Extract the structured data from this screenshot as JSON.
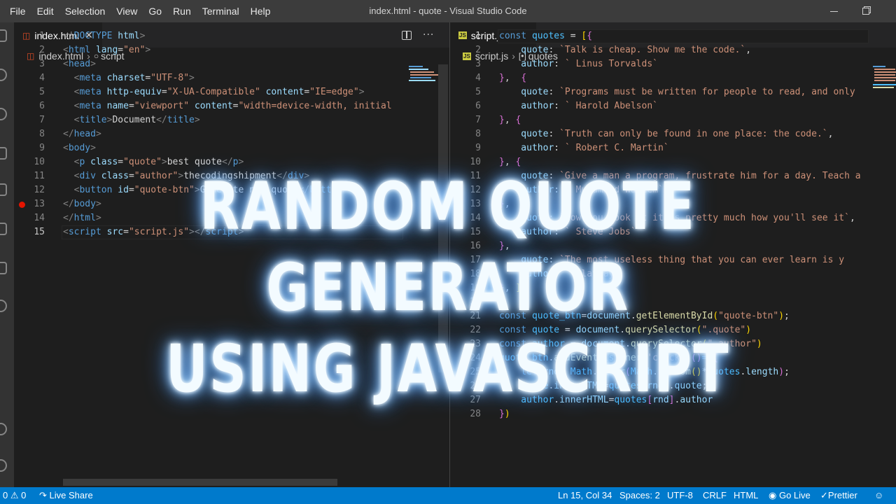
{
  "menu": [
    "File",
    "Edit",
    "Selection",
    "View",
    "Go",
    "Run",
    "Terminal",
    "Help"
  ],
  "window_title": "index.html - quote - Visual Studio Code",
  "left_editor": {
    "tab": "index.html",
    "breadcrumb": [
      "index.html",
      "script"
    ],
    "lines": [
      {
        "n": "1",
        "t": [
          [
            "<!",
            "punc"
          ],
          [
            "DOCTYPE",
            "tag"
          ],
          [
            " html",
            "attr"
          ],
          [
            ">",
            "punc"
          ]
        ]
      },
      {
        "n": "2",
        "t": [
          [
            "<",
            "punc"
          ],
          [
            "html",
            "tag"
          ],
          [
            " lang",
            "attr"
          ],
          [
            "=",
            "op"
          ],
          [
            "\"en\"",
            "str"
          ],
          [
            ">",
            "punc"
          ]
        ]
      },
      {
        "n": "3",
        "t": [
          [
            "<",
            "punc"
          ],
          [
            "head",
            "tag"
          ],
          [
            ">",
            "punc"
          ]
        ]
      },
      {
        "n": "4",
        "t": [
          [
            "  <",
            "punc"
          ],
          [
            "meta",
            "tag"
          ],
          [
            " charset",
            "attr"
          ],
          [
            "=",
            "op"
          ],
          [
            "\"UTF-8\"",
            "str"
          ],
          [
            ">",
            "punc"
          ]
        ]
      },
      {
        "n": "5",
        "t": [
          [
            "  <",
            "punc"
          ],
          [
            "meta",
            "tag"
          ],
          [
            " http-equiv",
            "attr"
          ],
          [
            "=",
            "op"
          ],
          [
            "\"X-UA-Compatible\"",
            "str"
          ],
          [
            " content",
            "attr"
          ],
          [
            "=",
            "op"
          ],
          [
            "\"IE=edge\"",
            "str"
          ],
          [
            ">",
            "punc"
          ]
        ]
      },
      {
        "n": "6",
        "t": [
          [
            "  <",
            "punc"
          ],
          [
            "meta",
            "tag"
          ],
          [
            " name",
            "attr"
          ],
          [
            "=",
            "op"
          ],
          [
            "\"viewport\"",
            "str"
          ],
          [
            " content",
            "attr"
          ],
          [
            "=",
            "op"
          ],
          [
            "\"width=device-width, initial",
            "str"
          ]
        ]
      },
      {
        "n": "7",
        "t": [
          [
            "  <",
            "punc"
          ],
          [
            "title",
            "tag"
          ],
          [
            ">",
            "punc"
          ],
          [
            "Document",
            "op"
          ],
          [
            "</",
            "punc"
          ],
          [
            "title",
            "tag"
          ],
          [
            ">",
            "punc"
          ]
        ]
      },
      {
        "n": "8",
        "t": [
          [
            "</",
            "punc"
          ],
          [
            "head",
            "tag"
          ],
          [
            ">",
            "punc"
          ]
        ]
      },
      {
        "n": "9",
        "t": [
          [
            "<",
            "punc"
          ],
          [
            "body",
            "tag"
          ],
          [
            ">",
            "punc"
          ]
        ]
      },
      {
        "n": "10",
        "t": [
          [
            "  <",
            "punc"
          ],
          [
            "p",
            "tag"
          ],
          [
            " class",
            "attr"
          ],
          [
            "=",
            "op"
          ],
          [
            "\"quote\"",
            "str"
          ],
          [
            ">",
            "punc"
          ],
          [
            "best quote",
            "op"
          ],
          [
            "</",
            "punc"
          ],
          [
            "p",
            "tag"
          ],
          [
            ">",
            "punc"
          ]
        ]
      },
      {
        "n": "11",
        "t": [
          [
            "  <",
            "punc"
          ],
          [
            "div",
            "tag"
          ],
          [
            " class",
            "attr"
          ],
          [
            "=",
            "op"
          ],
          [
            "\"author\"",
            "str"
          ],
          [
            ">",
            "punc"
          ],
          [
            "thecodingshipment",
            "op"
          ],
          [
            "</",
            "punc"
          ],
          [
            "div",
            "tag"
          ],
          [
            ">",
            "punc"
          ]
        ]
      },
      {
        "n": "12",
        "t": [
          [
            "  <",
            "punc"
          ],
          [
            "button",
            "tag"
          ],
          [
            " id",
            "attr"
          ],
          [
            "=",
            "op"
          ],
          [
            "\"quote-btn\"",
            "str"
          ],
          [
            ">",
            "punc"
          ],
          [
            "Generate new quote",
            "op"
          ],
          [
            "</",
            "punc"
          ],
          [
            "button",
            "tag"
          ],
          [
            ">",
            "punc"
          ]
        ]
      },
      {
        "n": "13",
        "t": [
          [
            "</",
            "punc"
          ],
          [
            "body",
            "tag"
          ],
          [
            ">",
            "punc"
          ]
        ],
        "breakpoint": true
      },
      {
        "n": "14",
        "t": [
          [
            "</",
            "punc"
          ],
          [
            "html",
            "tag"
          ],
          [
            ">",
            "punc"
          ]
        ]
      },
      {
        "n": "15",
        "t": [
          [
            "<",
            "punc"
          ],
          [
            "script",
            "tag"
          ],
          [
            " src",
            "attr"
          ],
          [
            "=",
            "op"
          ],
          [
            "\"script.js\"",
            "str"
          ],
          [
            ">",
            "punc"
          ],
          [
            "</",
            "punc"
          ],
          [
            "script",
            "tag"
          ],
          [
            ">",
            "punc"
          ]
        ],
        "active": true
      }
    ]
  },
  "right_editor": {
    "tab": "script.js",
    "breadcrumb": [
      "script.js",
      "quotes"
    ],
    "lines": [
      {
        "n": "1",
        "t": [
          [
            "const",
            "kw"
          ],
          [
            " quotes",
            "var"
          ],
          [
            " = ",
            "op"
          ],
          [
            "[",
            "br1"
          ],
          [
            "{",
            "br2"
          ]
        ],
        "active": true
      },
      {
        "n": "2",
        "t": [
          [
            "    quote",
            "prop"
          ],
          [
            ": ",
            "op"
          ],
          [
            "`Talk is cheap. Show me the code.`",
            "str"
          ],
          [
            ",",
            "op"
          ]
        ]
      },
      {
        "n": "3",
        "t": [
          [
            "    author",
            "prop"
          ],
          [
            ": ",
            "op"
          ],
          [
            "` Linus Torvalds`",
            "str"
          ]
        ]
      },
      {
        "n": "4",
        "t": [
          [
            "}",
            "br2"
          ],
          [
            ",  ",
            "op"
          ],
          [
            "{",
            "br2"
          ]
        ]
      },
      {
        "n": "5",
        "t": [
          [
            "    quote",
            "prop"
          ],
          [
            ": ",
            "op"
          ],
          [
            "`Programs must be written for people to read, and only",
            "str"
          ]
        ]
      },
      {
        "n": "6",
        "t": [
          [
            "    author",
            "prop"
          ],
          [
            ": ",
            "op"
          ],
          [
            "` Harold Abelson`",
            "str"
          ]
        ]
      },
      {
        "n": "7",
        "t": [
          [
            "}",
            "br2"
          ],
          [
            ", ",
            "op"
          ],
          [
            "{",
            "br2"
          ]
        ]
      },
      {
        "n": "8",
        "t": [
          [
            "    quote",
            "prop"
          ],
          [
            ": ",
            "op"
          ],
          [
            "`Truth can only be found in one place: the code.`",
            "str"
          ],
          [
            ",",
            "op"
          ]
        ]
      },
      {
        "n": "9",
        "t": [
          [
            "    author",
            "prop"
          ],
          [
            ": ",
            "op"
          ],
          [
            "` Robert C. Martin`",
            "str"
          ]
        ]
      },
      {
        "n": "10",
        "t": [
          [
            "}",
            "br2"
          ],
          [
            ", ",
            "op"
          ],
          [
            "{",
            "br2"
          ]
        ]
      },
      {
        "n": "11",
        "t": [
          [
            "    quote",
            "prop"
          ],
          [
            ": ",
            "op"
          ],
          [
            "`Give a man a program, frustrate him for a day. Teach a",
            "str"
          ]
        ]
      },
      {
        "n": "12",
        "t": [
          [
            "    author",
            "prop"
          ],
          [
            ": ",
            "op"
          ],
          [
            "` Muhammad Waseem`",
            "str"
          ]
        ]
      },
      {
        "n": "13",
        "t": [
          [
            "}",
            "br2"
          ],
          [
            ",",
            "op"
          ]
        ]
      },
      {
        "n": "14",
        "t": [
          [
            "    quote",
            "prop"
          ],
          [
            ": ",
            "op"
          ],
          [
            "`How you look at it is pretty much how you'll see it`",
            "str"
          ],
          [
            ",",
            "op"
          ]
        ]
      },
      {
        "n": "15",
        "t": [
          [
            "    author",
            "prop"
          ],
          [
            ": ",
            "op"
          ],
          [
            "` Steve Jobs`",
            "str"
          ]
        ]
      },
      {
        "n": "16",
        "t": [
          [
            "}",
            "br2"
          ],
          [
            ",",
            "op"
          ]
        ]
      },
      {
        "n": "17",
        "t": [
          [
            "    quote",
            "prop"
          ],
          [
            ": ",
            "op"
          ],
          [
            "`The most useless thing that you can ever learn is y",
            "str"
          ]
        ]
      },
      {
        "n": "18",
        "t": [
          [
            "    author",
            "prop"
          ],
          [
            ": ",
            "op"
          ],
          [
            "` Playday`",
            "str"
          ]
        ]
      },
      {
        "n": "19",
        "t": [
          [
            "}",
            "br2"
          ],
          [
            ", ",
            "op"
          ],
          [
            "]",
            "br1"
          ]
        ]
      },
      {
        "n": "20",
        "t": []
      },
      {
        "n": "21",
        "t": [
          [
            "const",
            "kw"
          ],
          [
            " quote_btn",
            "var"
          ],
          [
            "=",
            "op"
          ],
          [
            "document",
            "prop"
          ],
          [
            ".",
            "op"
          ],
          [
            "getElementById",
            "fn"
          ],
          [
            "(",
            "br1"
          ],
          [
            "\"quote-btn\"",
            "str"
          ],
          [
            ")",
            "br1"
          ],
          [
            ";",
            "op"
          ]
        ]
      },
      {
        "n": "22",
        "t": [
          [
            "const",
            "kw"
          ],
          [
            " quote",
            "var"
          ],
          [
            " = ",
            "op"
          ],
          [
            "document",
            "prop"
          ],
          [
            ".",
            "op"
          ],
          [
            "querySelector",
            "fn"
          ],
          [
            "(",
            "br1"
          ],
          [
            "\".quote\"",
            "str"
          ],
          [
            ")",
            "br1"
          ]
        ]
      },
      {
        "n": "23",
        "t": [
          [
            "const",
            "kw"
          ],
          [
            " author",
            "var"
          ],
          [
            " = ",
            "op"
          ],
          [
            "document",
            "prop"
          ],
          [
            ".",
            "op"
          ],
          [
            "querySelector",
            "fn"
          ],
          [
            "(",
            "br1"
          ],
          [
            "\".author\"",
            "str"
          ],
          [
            ")",
            "br1"
          ]
        ]
      },
      {
        "n": "24",
        "t": [
          [
            "quote_btn",
            "var"
          ],
          [
            ".",
            "op"
          ],
          [
            "addEventListener",
            "fn"
          ],
          [
            "(",
            "br1"
          ],
          [
            "'click'",
            "str"
          ],
          [
            ",",
            "op"
          ],
          [
            "()",
            "br2"
          ],
          [
            "=>",
            "kw"
          ],
          [
            "{",
            "br2"
          ]
        ]
      },
      {
        "n": "25",
        "t": [
          [
            "    let",
            "kw"
          ],
          [
            " rnd",
            "prop"
          ],
          [
            "= ",
            "op"
          ],
          [
            "Math",
            "var"
          ],
          [
            ".",
            "op"
          ],
          [
            "floor",
            "fn"
          ],
          [
            "(",
            "br2"
          ],
          [
            "Math",
            "var"
          ],
          [
            ".",
            "op"
          ],
          [
            "random",
            "fn"
          ],
          [
            "()",
            "br1"
          ],
          [
            "*",
            "op"
          ],
          [
            "quotes",
            "var"
          ],
          [
            ".",
            "op"
          ],
          [
            "length",
            "prop"
          ],
          [
            ")",
            "br2"
          ],
          [
            ";",
            "op"
          ]
        ]
      },
      {
        "n": "26",
        "t": [
          [
            "    quote",
            "var"
          ],
          [
            ".",
            "op"
          ],
          [
            "innerHTML",
            "prop"
          ],
          [
            "=",
            "op"
          ],
          [
            "quotes",
            "var"
          ],
          [
            "[",
            "br2"
          ],
          [
            "rnd",
            "prop"
          ],
          [
            "]",
            "br2"
          ],
          [
            ".",
            "op"
          ],
          [
            "quote",
            "prop"
          ],
          [
            ";",
            "op"
          ]
        ]
      },
      {
        "n": "27",
        "t": [
          [
            "    author",
            "var"
          ],
          [
            ".",
            "op"
          ],
          [
            "innerHTML",
            "prop"
          ],
          [
            "=",
            "op"
          ],
          [
            "quotes",
            "var"
          ],
          [
            "[",
            "br2"
          ],
          [
            "rnd",
            "prop"
          ],
          [
            "]",
            "br2"
          ],
          [
            ".",
            "op"
          ],
          [
            "author",
            "prop"
          ]
        ]
      },
      {
        "n": "28",
        "t": [
          [
            "}",
            "br2"
          ],
          [
            ")",
            "br1"
          ]
        ]
      }
    ]
  },
  "overlay": {
    "line1": "RANDOM QUOTE GENERATOR",
    "line2": "USING JAVASCRIPT"
  },
  "status": {
    "problems": "0 ⚠ 0",
    "live_share": "Live Share",
    "cursor": "Ln 15, Col 34",
    "spaces": "Spaces: 2",
    "encoding": "UTF-8",
    "eol": "CRLF",
    "language": "HTML",
    "go_live": "Go Live",
    "prettier": "Prettier"
  },
  "colors": {
    "accent": "#007acc",
    "editor_bg": "#1e1e1e",
    "title_bg": "#3c3c3c",
    "glow": "#7fbfff"
  },
  "icons": [
    "split-editor-icon",
    "more-actions-icon",
    "close-icon",
    "html-file-icon",
    "js-file-icon",
    "symbol-icon",
    "live-share-icon",
    "broadcast-icon",
    "check-icon",
    "feedback-icon",
    "minimize-icon",
    "maximize-icon"
  ]
}
